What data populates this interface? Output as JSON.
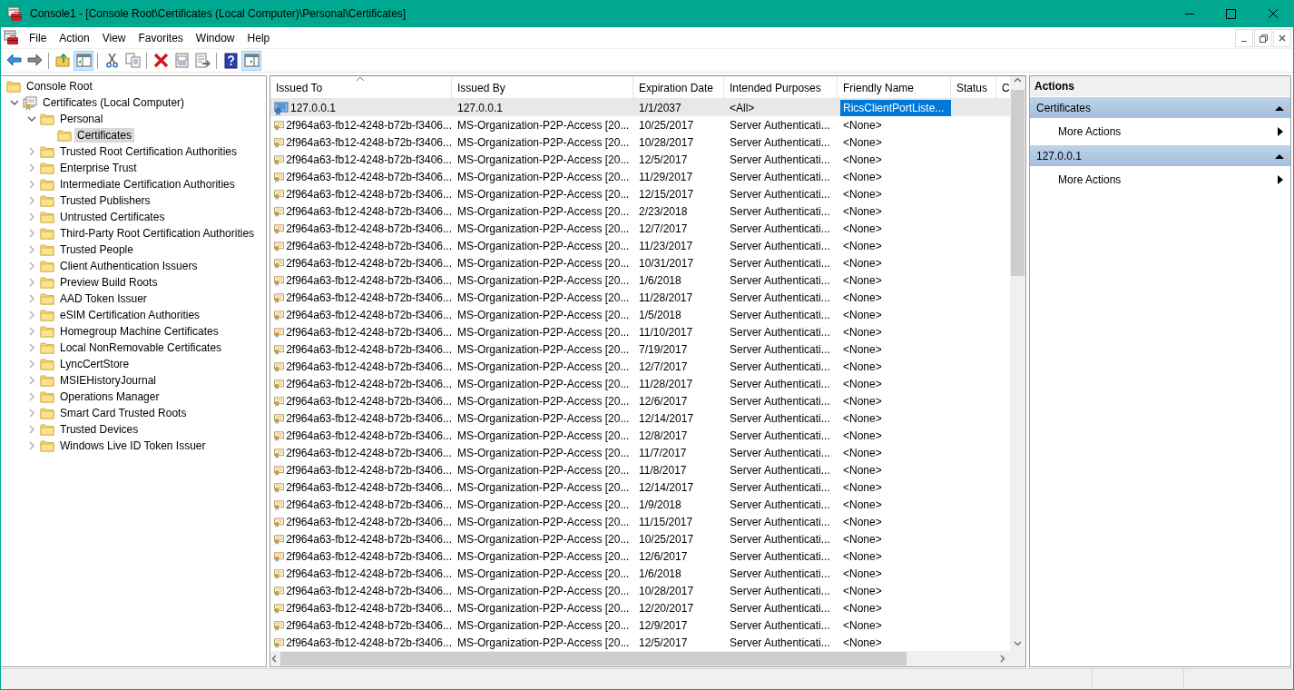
{
  "window": {
    "title": "Console1 - [Console Root\\Certificates (Local Computer)\\Personal\\Certificates]"
  },
  "menu": [
    "File",
    "Action",
    "View",
    "Favorites",
    "Window",
    "Help"
  ],
  "toolbar": [
    {
      "kind": "back",
      "pressed": false
    },
    {
      "kind": "forward",
      "pressed": false
    },
    {
      "kind": "separator"
    },
    {
      "kind": "up",
      "pressed": false
    },
    {
      "kind": "tree-pane",
      "pressed": true
    },
    {
      "kind": "separator"
    },
    {
      "kind": "cut",
      "pressed": false
    },
    {
      "kind": "copy",
      "pressed": false
    },
    {
      "kind": "separator"
    },
    {
      "kind": "delete",
      "pressed": false
    },
    {
      "kind": "properties",
      "pressed": false
    },
    {
      "kind": "export",
      "pressed": false
    },
    {
      "kind": "separator"
    },
    {
      "kind": "help",
      "pressed": false
    },
    {
      "kind": "action-pane",
      "pressed": true
    }
  ],
  "tree": {
    "items": [
      {
        "label": "Console Root",
        "selected": false,
        "children": [
          {
            "label": "Certificates (Local Computer)",
            "expanded": true,
            "selected": false,
            "children": [
              {
                "label": "Personal",
                "expanded": true,
                "selected": false,
                "children": [
                  {
                    "label": "Certificates",
                    "selected": true
                  }
                ]
              },
              {
                "label": "Trusted Root Certification Authorities",
                "expanded": false,
                "selected": false
              },
              {
                "label": "Enterprise Trust",
                "expanded": false,
                "selected": false
              },
              {
                "label": "Intermediate Certification Authorities",
                "expanded": false,
                "selected": false
              },
              {
                "label": "Trusted Publishers",
                "expanded": false,
                "selected": false
              },
              {
                "label": "Untrusted Certificates",
                "expanded": false,
                "selected": false
              },
              {
                "label": "Third-Party Root Certification Authorities",
                "expanded": false,
                "selected": false
              },
              {
                "label": "Trusted People",
                "expanded": false,
                "selected": false
              },
              {
                "label": "Client Authentication Issuers",
                "expanded": false,
                "selected": false
              },
              {
                "label": "Preview Build Roots",
                "expanded": false,
                "selected": false
              },
              {
                "label": "AAD Token Issuer",
                "expanded": false,
                "selected": false
              },
              {
                "label": "eSIM Certification Authorities",
                "expanded": false,
                "selected": false
              },
              {
                "label": "Homegroup Machine Certificates",
                "expanded": false,
                "selected": false
              },
              {
                "label": "Local NonRemovable Certificates",
                "expanded": false,
                "selected": false
              },
              {
                "label": "LyncCertStore",
                "expanded": false,
                "selected": false
              },
              {
                "label": "MSIEHistoryJournal",
                "expanded": false,
                "selected": false
              },
              {
                "label": "Operations Manager",
                "expanded": false,
                "selected": false
              },
              {
                "label": "Smart Card Trusted Roots",
                "expanded": false,
                "selected": false
              },
              {
                "label": "Trusted Devices",
                "expanded": false,
                "selected": false
              },
              {
                "label": "Windows Live ID Token Issuer",
                "expanded": false,
                "selected": false
              }
            ]
          }
        ]
      }
    ]
  },
  "table": {
    "columns": [
      {
        "label": "Issued To",
        "sorted": true
      },
      {
        "label": "Issued By"
      },
      {
        "label": "Expiration Date"
      },
      {
        "label": "Intended Purposes"
      },
      {
        "label": "Friendly Name"
      },
      {
        "label": "Status"
      },
      {
        "label": "C"
      }
    ],
    "rows": [
      {
        "kind": "root",
        "issued_to": "127.0.0.1",
        "issued_by": "127.0.0.1",
        "expiration_date": "1/1/2037",
        "intended_purposes": "<All>",
        "friendly_name": "RicsClientPortListe...",
        "selected": true
      },
      {
        "kind": "issued",
        "issued_to": "2f964a63-fb12-4248-b72b-f3406...",
        "issued_by": "MS-Organization-P2P-Access [20...",
        "expiration_date": "10/25/2017",
        "intended_purposes": "Server Authenticati...",
        "friendly_name": "<None>",
        "selected": false
      },
      {
        "kind": "issued",
        "issued_to": "2f964a63-fb12-4248-b72b-f3406...",
        "issued_by": "MS-Organization-P2P-Access [20...",
        "expiration_date": "10/28/2017",
        "intended_purposes": "Server Authenticati...",
        "friendly_name": "<None>",
        "selected": false
      },
      {
        "kind": "issued",
        "issued_to": "2f964a63-fb12-4248-b72b-f3406...",
        "issued_by": "MS-Organization-P2P-Access [20...",
        "expiration_date": "12/5/2017",
        "intended_purposes": "Server Authenticati...",
        "friendly_name": "<None>",
        "selected": false
      },
      {
        "kind": "issued",
        "issued_to": "2f964a63-fb12-4248-b72b-f3406...",
        "issued_by": "MS-Organization-P2P-Access [20...",
        "expiration_date": "11/29/2017",
        "intended_purposes": "Server Authenticati...",
        "friendly_name": "<None>",
        "selected": false
      },
      {
        "kind": "issued",
        "issued_to": "2f964a63-fb12-4248-b72b-f3406...",
        "issued_by": "MS-Organization-P2P-Access [20...",
        "expiration_date": "12/15/2017",
        "intended_purposes": "Server Authenticati...",
        "friendly_name": "<None>",
        "selected": false
      },
      {
        "kind": "issued",
        "issued_to": "2f964a63-fb12-4248-b72b-f3406...",
        "issued_by": "MS-Organization-P2P-Access [20...",
        "expiration_date": "2/23/2018",
        "intended_purposes": "Server Authenticati...",
        "friendly_name": "<None>",
        "selected": false
      },
      {
        "kind": "issued",
        "issued_to": "2f964a63-fb12-4248-b72b-f3406...",
        "issued_by": "MS-Organization-P2P-Access [20...",
        "expiration_date": "12/7/2017",
        "intended_purposes": "Server Authenticati...",
        "friendly_name": "<None>",
        "selected": false
      },
      {
        "kind": "issued",
        "issued_to": "2f964a63-fb12-4248-b72b-f3406...",
        "issued_by": "MS-Organization-P2P-Access [20...",
        "expiration_date": "11/23/2017",
        "intended_purposes": "Server Authenticati...",
        "friendly_name": "<None>",
        "selected": false
      },
      {
        "kind": "issued",
        "issued_to": "2f964a63-fb12-4248-b72b-f3406...",
        "issued_by": "MS-Organization-P2P-Access [20...",
        "expiration_date": "10/31/2017",
        "intended_purposes": "Server Authenticati...",
        "friendly_name": "<None>",
        "selected": false
      },
      {
        "kind": "issued",
        "issued_to": "2f964a63-fb12-4248-b72b-f3406...",
        "issued_by": "MS-Organization-P2P-Access [20...",
        "expiration_date": "1/6/2018",
        "intended_purposes": "Server Authenticati...",
        "friendly_name": "<None>",
        "selected": false
      },
      {
        "kind": "issued",
        "issued_to": "2f964a63-fb12-4248-b72b-f3406...",
        "issued_by": "MS-Organization-P2P-Access [20...",
        "expiration_date": "11/28/2017",
        "intended_purposes": "Server Authenticati...",
        "friendly_name": "<None>",
        "selected": false
      },
      {
        "kind": "issued",
        "issued_to": "2f964a63-fb12-4248-b72b-f3406...",
        "issued_by": "MS-Organization-P2P-Access [20...",
        "expiration_date": "1/5/2018",
        "intended_purposes": "Server Authenticati...",
        "friendly_name": "<None>",
        "selected": false
      },
      {
        "kind": "issued",
        "issued_to": "2f964a63-fb12-4248-b72b-f3406...",
        "issued_by": "MS-Organization-P2P-Access [20...",
        "expiration_date": "11/10/2017",
        "intended_purposes": "Server Authenticati...",
        "friendly_name": "<None>",
        "selected": false
      },
      {
        "kind": "issued",
        "issued_to": "2f964a63-fb12-4248-b72b-f3406...",
        "issued_by": "MS-Organization-P2P-Access [20...",
        "expiration_date": "7/19/2017",
        "intended_purposes": "Server Authenticati...",
        "friendly_name": "<None>",
        "selected": false
      },
      {
        "kind": "issued",
        "issued_to": "2f964a63-fb12-4248-b72b-f3406...",
        "issued_by": "MS-Organization-P2P-Access [20...",
        "expiration_date": "12/7/2017",
        "intended_purposes": "Server Authenticati...",
        "friendly_name": "<None>",
        "selected": false
      },
      {
        "kind": "issued",
        "issued_to": "2f964a63-fb12-4248-b72b-f3406...",
        "issued_by": "MS-Organization-P2P-Access [20...",
        "expiration_date": "11/28/2017",
        "intended_purposes": "Server Authenticati...",
        "friendly_name": "<None>",
        "selected": false
      },
      {
        "kind": "issued",
        "issued_to": "2f964a63-fb12-4248-b72b-f3406...",
        "issued_by": "MS-Organization-P2P-Access [20...",
        "expiration_date": "12/6/2017",
        "intended_purposes": "Server Authenticati...",
        "friendly_name": "<None>",
        "selected": false
      },
      {
        "kind": "issued",
        "issued_to": "2f964a63-fb12-4248-b72b-f3406...",
        "issued_by": "MS-Organization-P2P-Access [20...",
        "expiration_date": "12/14/2017",
        "intended_purposes": "Server Authenticati...",
        "friendly_name": "<None>",
        "selected": false
      },
      {
        "kind": "issued",
        "issued_to": "2f964a63-fb12-4248-b72b-f3406...",
        "issued_by": "MS-Organization-P2P-Access [20...",
        "expiration_date": "12/8/2017",
        "intended_purposes": "Server Authenticati...",
        "friendly_name": "<None>",
        "selected": false
      },
      {
        "kind": "issued",
        "issued_to": "2f964a63-fb12-4248-b72b-f3406...",
        "issued_by": "MS-Organization-P2P-Access [20...",
        "expiration_date": "11/7/2017",
        "intended_purposes": "Server Authenticati...",
        "friendly_name": "<None>",
        "selected": false
      },
      {
        "kind": "issued",
        "issued_to": "2f964a63-fb12-4248-b72b-f3406...",
        "issued_by": "MS-Organization-P2P-Access [20...",
        "expiration_date": "11/8/2017",
        "intended_purposes": "Server Authenticati...",
        "friendly_name": "<None>",
        "selected": false
      },
      {
        "kind": "issued",
        "issued_to": "2f964a63-fb12-4248-b72b-f3406...",
        "issued_by": "MS-Organization-P2P-Access [20...",
        "expiration_date": "12/14/2017",
        "intended_purposes": "Server Authenticati...",
        "friendly_name": "<None>",
        "selected": false
      },
      {
        "kind": "issued",
        "issued_to": "2f964a63-fb12-4248-b72b-f3406...",
        "issued_by": "MS-Organization-P2P-Access [20...",
        "expiration_date": "1/9/2018",
        "intended_purposes": "Server Authenticati...",
        "friendly_name": "<None>",
        "selected": false
      },
      {
        "kind": "issued",
        "issued_to": "2f964a63-fb12-4248-b72b-f3406...",
        "issued_by": "MS-Organization-P2P-Access [20...",
        "expiration_date": "11/15/2017",
        "intended_purposes": "Server Authenticati...",
        "friendly_name": "<None>",
        "selected": false
      },
      {
        "kind": "issued",
        "issued_to": "2f964a63-fb12-4248-b72b-f3406...",
        "issued_by": "MS-Organization-P2P-Access [20...",
        "expiration_date": "10/25/2017",
        "intended_purposes": "Server Authenticati...",
        "friendly_name": "<None>",
        "selected": false
      },
      {
        "kind": "issued",
        "issued_to": "2f964a63-fb12-4248-b72b-f3406...",
        "issued_by": "MS-Organization-P2P-Access [20...",
        "expiration_date": "12/6/2017",
        "intended_purposes": "Server Authenticati...",
        "friendly_name": "<None>",
        "selected": false
      },
      {
        "kind": "issued",
        "issued_to": "2f964a63-fb12-4248-b72b-f3406...",
        "issued_by": "MS-Organization-P2P-Access [20...",
        "expiration_date": "1/6/2018",
        "intended_purposes": "Server Authenticati...",
        "friendly_name": "<None>",
        "selected": false
      },
      {
        "kind": "issued",
        "issued_to": "2f964a63-fb12-4248-b72b-f3406...",
        "issued_by": "MS-Organization-P2P-Access [20...",
        "expiration_date": "10/28/2017",
        "intended_purposes": "Server Authenticati...",
        "friendly_name": "<None>",
        "selected": false
      },
      {
        "kind": "issued",
        "issued_to": "2f964a63-fb12-4248-b72b-f3406...",
        "issued_by": "MS-Organization-P2P-Access [20...",
        "expiration_date": "12/20/2017",
        "intended_purposes": "Server Authenticati...",
        "friendly_name": "<None>",
        "selected": false
      },
      {
        "kind": "issued",
        "issued_to": "2f964a63-fb12-4248-b72b-f3406...",
        "issued_by": "MS-Organization-P2P-Access [20...",
        "expiration_date": "12/9/2017",
        "intended_purposes": "Server Authenticati...",
        "friendly_name": "<None>",
        "selected": false
      },
      {
        "kind": "issued",
        "issued_to": "2f964a63-fb12-4248-b72b-f3406...",
        "issued_by": "MS-Organization-P2P-Access [20...",
        "expiration_date": "12/5/2017",
        "intended_purposes": "Server Authenticati...",
        "friendly_name": "<None>",
        "selected": false
      }
    ]
  },
  "actions": {
    "title": "Actions",
    "sections": [
      {
        "title": "Certificates",
        "expanded": true,
        "items": [
          {
            "label": "More Actions",
            "submenu": true
          }
        ]
      },
      {
        "title": "127.0.0.1",
        "expanded": true,
        "items": [
          {
            "label": "More Actions",
            "submenu": true
          }
        ]
      }
    ]
  }
}
